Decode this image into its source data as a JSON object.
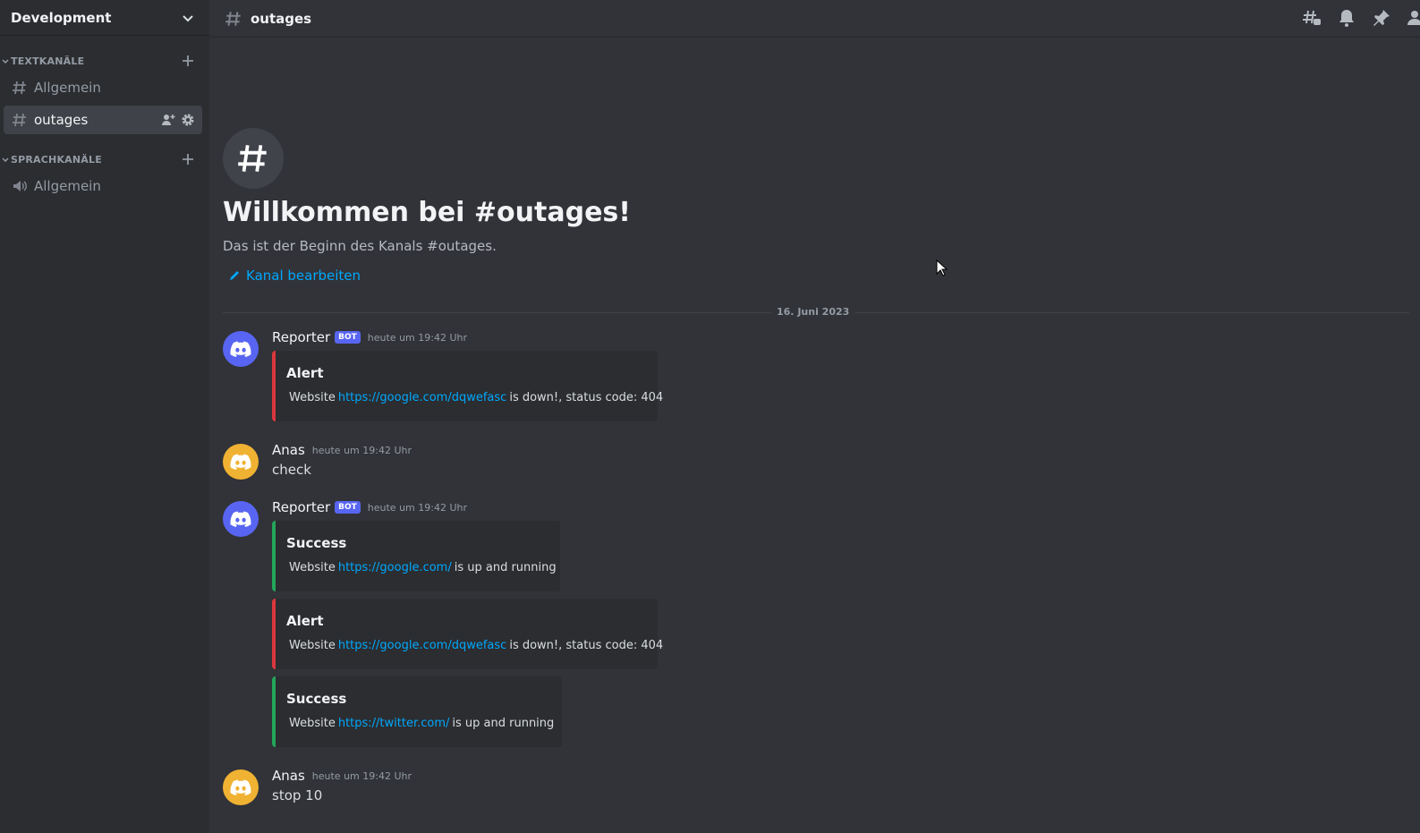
{
  "server": {
    "name": "Development"
  },
  "sidebar": {
    "categories": [
      {
        "label": "TEXTKANÄLE",
        "channels": [
          {
            "name": "Allgemein",
            "type": "text"
          },
          {
            "name": "outages",
            "type": "text",
            "active": true
          }
        ]
      },
      {
        "label": "SPRACHKANÄLE",
        "channels": [
          {
            "name": "Allgemein",
            "type": "voice"
          }
        ]
      }
    ]
  },
  "header": {
    "channel_name": "outages"
  },
  "welcome": {
    "title": "Willkommen bei #outages!",
    "subtitle": "Das ist der Beginn des Kanals #outages.",
    "edit_label": "Kanal bearbeiten"
  },
  "date_divider": "16. Juni 2023",
  "messages": [
    {
      "author": "Reporter",
      "bot": true,
      "badge": "BOT",
      "time": "heute um 19:42 Uhr",
      "embeds": [
        {
          "kind": "alert",
          "title": "Alert",
          "prefix": "Website",
          "link": "https://google.com/dqwefasc",
          "suffix": "is down!, status code: 404"
        }
      ]
    },
    {
      "author": "Anas",
      "bot": false,
      "time": "heute um 19:42 Uhr",
      "text": "check"
    },
    {
      "author": "Reporter",
      "bot": true,
      "badge": "BOT",
      "time": "heute um 19:42 Uhr",
      "embeds": [
        {
          "kind": "success",
          "title": "Success",
          "prefix": "Website",
          "link": "https://google.com/",
          "suffix": "is up and running"
        },
        {
          "kind": "alert",
          "title": "Alert",
          "prefix": "Website",
          "link": "https://google.com/dqwefasc",
          "suffix": "is down!, status code: 404"
        },
        {
          "kind": "success",
          "title": "Success",
          "prefix": "Website",
          "link": "https://twitter.com/",
          "suffix": "is up and running"
        }
      ]
    },
    {
      "author": "Anas",
      "bot": false,
      "time": "heute um 19:42 Uhr",
      "text": "stop 10"
    }
  ],
  "colors": {
    "alert": "#da373c",
    "success": "#23a55a",
    "link": "#00a8fc",
    "blurple": "#5865f2",
    "user_avatar": "#f0b232"
  },
  "icons": {
    "topbar": [
      "threads-icon",
      "bell-icon",
      "pin-icon",
      "member-list-icon"
    ],
    "alert_emoji": "cross-mark-icon",
    "success_emoji": "check-mark-icon"
  }
}
